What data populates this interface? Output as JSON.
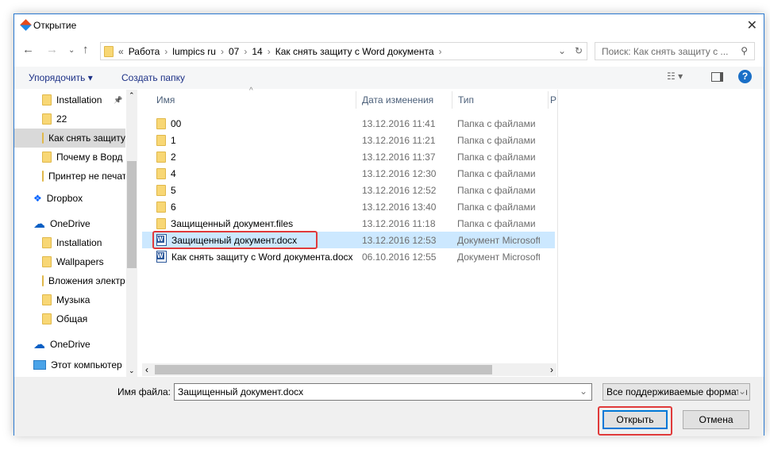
{
  "title": "Открытие",
  "address": {
    "crumbs": [
      "«",
      "Работа",
      "lumpics ru",
      "07",
      "14",
      "Как снять защиту с Word документа"
    ]
  },
  "search": {
    "placeholder": "Поиск: Как снять защиту с ..."
  },
  "toolbar": {
    "organize": "Упорядочить",
    "new_folder": "Создать папку"
  },
  "sidebar": [
    {
      "label": "Installation",
      "icon": "folder-icon",
      "indent": true,
      "pinned": true
    },
    {
      "label": "22",
      "icon": "folder-icon",
      "indent": true
    },
    {
      "label": "Как снять защиту",
      "icon": "folder-icon",
      "indent": true,
      "selected": true
    },
    {
      "label": "Почему в Ворд",
      "icon": "folder-icon",
      "indent": true
    },
    {
      "label": "Принтер не печатает",
      "icon": "folder-icon",
      "indent": true
    },
    {
      "label": "Dropbox",
      "icon": "dropbox-icon"
    },
    {
      "label": "OneDrive",
      "icon": "onedrive-icon"
    },
    {
      "label": "Installation",
      "icon": "folder-icon",
      "indent": true
    },
    {
      "label": "Wallpapers",
      "icon": "folder-icon",
      "indent": true
    },
    {
      "label": "Вложения электронной почты",
      "icon": "folder-icon",
      "indent": true
    },
    {
      "label": "Музыка",
      "icon": "folder-icon",
      "indent": true
    },
    {
      "label": "Общая",
      "icon": "folder-icon",
      "indent": true
    },
    {
      "label": "OneDrive",
      "icon": "onedrive-icon"
    },
    {
      "label": "Этот компьютер",
      "icon": "computer-icon"
    }
  ],
  "columns": {
    "name": "Имя",
    "date": "Дата изменения",
    "type": "Тип",
    "size": "Р"
  },
  "files": [
    {
      "name": "00",
      "date": "13.12.2016 11:41",
      "type": "Папка с файлами",
      "icon": "folder"
    },
    {
      "name": "1",
      "date": "13.12.2016 11:21",
      "type": "Папка с файлами",
      "icon": "folder"
    },
    {
      "name": "2",
      "date": "13.12.2016 11:37",
      "type": "Папка с файлами",
      "icon": "folder"
    },
    {
      "name": "4",
      "date": "13.12.2016 12:30",
      "type": "Папка с файлами",
      "icon": "folder"
    },
    {
      "name": "5",
      "date": "13.12.2016 12:52",
      "type": "Папка с файлами",
      "icon": "folder"
    },
    {
      "name": "6",
      "date": "13.12.2016 13:40",
      "type": "Папка с файлами",
      "icon": "folder"
    },
    {
      "name": "Защищенный документ.files",
      "date": "13.12.2016 11:18",
      "type": "Папка с файлами",
      "icon": "folder"
    },
    {
      "name": "Защищенный документ.docx",
      "date": "13.12.2016 12:53",
      "type": "Документ Microsoft Word",
      "icon": "word",
      "selected": true
    },
    {
      "name": "Как снять защиту с Word документа.docx",
      "date": "06.10.2016 12:55",
      "type": "Документ Microsoft Word",
      "icon": "word"
    }
  ],
  "filename": {
    "label": "Имя файла:",
    "value": "Защищенный документ.docx"
  },
  "filter": {
    "value": "Все поддерживаемые форматы"
  },
  "buttons": {
    "open": "Открыть",
    "cancel": "Отмена"
  }
}
